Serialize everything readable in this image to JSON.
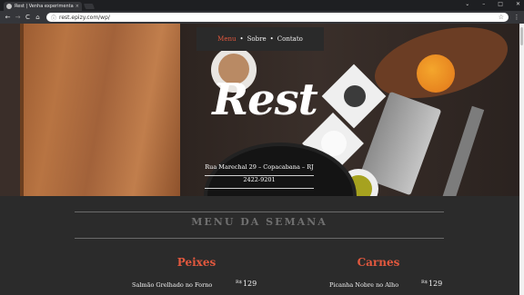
{
  "browser": {
    "tab_title": "Rest | Venha experimentar",
    "tab_close": "×",
    "url": "rest.epizy.com/wp/",
    "win_minimize": "–",
    "win_maximize": "□",
    "win_close": "✕",
    "win_chevron": "⌄",
    "back": "←",
    "forward": "→",
    "reload": "C",
    "home": "⌂",
    "lock": "ⓘ",
    "star": "☆",
    "menu": "⋮"
  },
  "site": {
    "nav": [
      {
        "label": "Menu",
        "active": true
      },
      {
        "label": "Sobre",
        "active": false
      },
      {
        "label": "Contato",
        "active": false
      }
    ],
    "nav_sep": "•",
    "logo": "Rest",
    "address": "Rua Marechal 29 – Copacabana – RJ",
    "phone": "2422-9201"
  },
  "menu": {
    "title": "MENU DA SEMANA",
    "columns": [
      {
        "heading": "Peixes",
        "items": [
          {
            "name": "Salmão Grelhado no Forno",
            "currency": "R$",
            "price": "129"
          }
        ]
      },
      {
        "heading": "Carnes",
        "items": [
          {
            "name": "Picanha Nobre no Alho",
            "currency": "R$",
            "price": "129"
          }
        ]
      }
    ]
  },
  "colors": {
    "accent": "#e2583e",
    "background": "#2b2b2b",
    "muted_title": "#6f6f6f"
  }
}
